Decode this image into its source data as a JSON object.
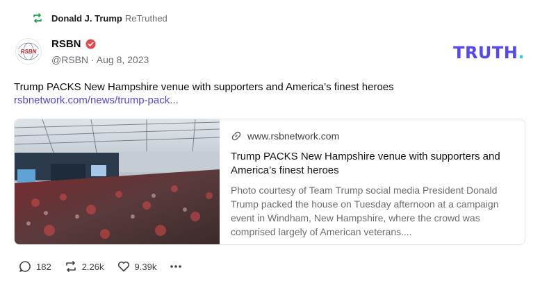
{
  "retruth": {
    "user": "Donald J. Trump",
    "action": "ReTruthed"
  },
  "author": {
    "name": "RSBN",
    "handle": "@RSBN",
    "date": "Aug 8, 2023",
    "avatar_text": "RSBN"
  },
  "brand": {
    "logo_text": "TRUTH",
    "logo_dot": "."
  },
  "post": {
    "text": "Trump PACKS New Hampshire venue with supporters and America’s finest heroes",
    "link": "rsbnetwork.com/news/trump-pack..."
  },
  "card": {
    "domain": "www.rsbnetwork.com",
    "title": "Trump PACKS New Hampshire venue with supporters and America’s finest heroes",
    "description": "Photo courtesy of Team Trump social media President Donald Trump packed the house on Tuesday afternoon at a campaign event in Windham, New Hampshire, where the crowd was comprised largely of American veterans...."
  },
  "actions": {
    "replies": "182",
    "retruths": "2.26k",
    "likes": "9.39k"
  },
  "colors": {
    "brand": "#5448ee",
    "brand_dot": "#2dd4bf",
    "verified": "#e5484d",
    "link": "#4f46e5",
    "retruth_icon": "#16a34a"
  }
}
